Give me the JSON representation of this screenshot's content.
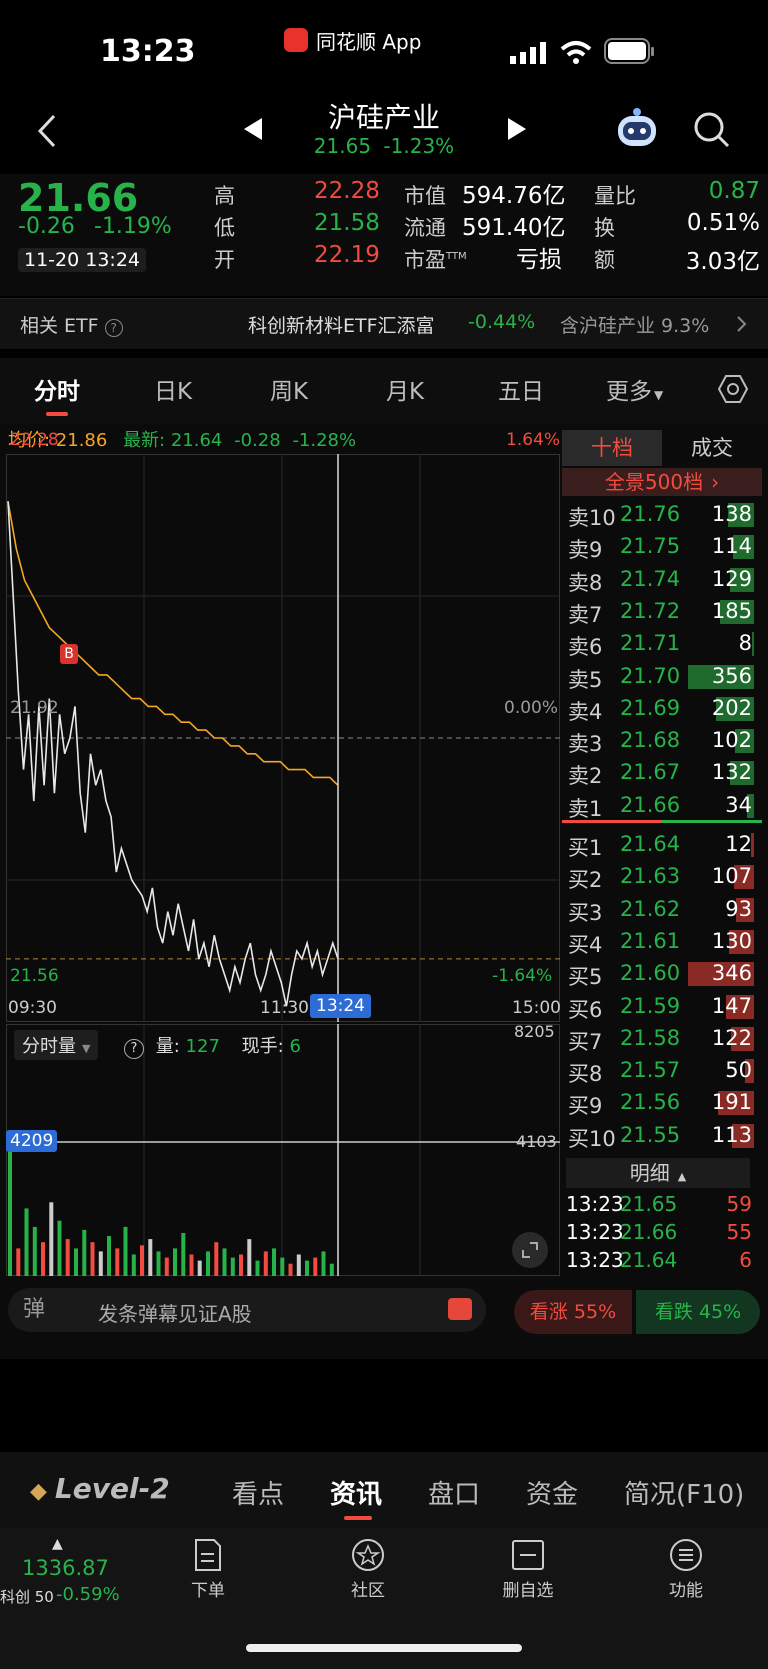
{
  "status_bar": {
    "time": "13:23",
    "app_name": "同花顺 App"
  },
  "header": {
    "title": "沪硅产业",
    "price": "21.65",
    "change_pct": "-1.23%"
  },
  "quote": {
    "price": "21.66",
    "change": "-0.26",
    "change_pct": "-1.19%",
    "datetime": "11-20 13:24",
    "high_label": "高",
    "high": "22.28",
    "low_label": "低",
    "low": "21.58",
    "open_label": "开",
    "open": "22.19",
    "mcap_label": "市值",
    "mcap": "594.76亿",
    "float_label": "流通",
    "float": "591.40亿",
    "pe_label": "市盈",
    "pe_sup": "TTM",
    "pe": "亏损",
    "vr_label": "量比",
    "vr": "0.87",
    "turnover_label": "换",
    "turnover": "0.51%",
    "amount_label": "额",
    "amount": "3.03亿"
  },
  "etf": {
    "label": "相关 ETF",
    "name": "科创新材料ETF汇添富",
    "change": "-0.44%",
    "holding": "含沪硅产业 9.3%"
  },
  "tabs": [
    "分时",
    "日K",
    "周K",
    "月K",
    "五日",
    "更多"
  ],
  "chart_info": {
    "avg_label": "均价: 21.86",
    "latest_label": "最新: 21.64",
    "latest_change": "-0.28",
    "latest_pct": "-1.28%"
  },
  "chart_data": {
    "type": "line",
    "x_ticks": [
      "09:30",
      "11:30",
      "15:00"
    ],
    "cursor_time": "13:24",
    "y_max": "22.28",
    "y_mid": "21.92",
    "y_min": "21.56",
    "pct_max": "1.64%",
    "pct_mid": "0.00%",
    "pct_min": "-1.64%",
    "ylim": [
      21.56,
      22.28
    ],
    "prev_close": 21.92,
    "price_series": [
      22.22,
      22.1,
      21.98,
      21.88,
      21.95,
      21.84,
      21.96,
      21.86,
      21.97,
      21.85,
      21.95,
      21.9,
      21.92,
      21.96,
      21.85,
      21.8,
      21.9,
      21.86,
      21.88,
      21.84,
      21.82,
      21.75,
      21.78,
      21.76,
      21.74,
      21.73,
      21.72,
      21.7,
      21.73,
      21.68,
      21.66,
      21.7,
      21.67,
      21.71,
      21.68,
      21.65,
      21.69,
      21.64,
      21.66,
      21.63,
      21.67,
      21.64,
      21.62,
      21.6,
      21.63,
      21.61,
      21.64,
      21.66,
      21.62,
      21.6,
      21.62,
      21.65,
      21.63,
      21.61,
      21.58,
      21.62,
      21.65,
      21.64,
      21.66,
      21.63,
      21.65,
      21.62,
      21.64,
      21.66,
      21.64
    ],
    "avg_series": [
      22.22,
      22.16,
      22.12,
      22.1,
      22.08,
      22.06,
      22.05,
      22.04,
      22.03,
      22.02,
      22.01,
      22.0,
      22.0,
      21.99,
      21.98,
      21.97,
      21.97,
      21.96,
      21.96,
      21.95,
      21.95,
      21.94,
      21.94,
      21.93,
      21.93,
      21.92,
      21.92,
      21.91,
      21.91,
      21.9,
      21.9,
      21.89,
      21.89,
      21.89,
      21.88,
      21.88,
      21.88,
      21.87,
      21.87,
      21.87,
      21.86
    ],
    "volume_series": [
      4209,
      900,
      2200,
      1600,
      1100,
      2400,
      1800,
      1200,
      900,
      1500,
      1100,
      800,
      1300,
      900,
      1600,
      700,
      1000,
      1200,
      800,
      600,
      900,
      1400,
      700,
      500,
      800,
      1100,
      900,
      600,
      700,
      1200,
      500,
      800,
      900,
      600,
      400,
      700,
      500,
      600,
      800,
      400
    ],
    "vol_max": "8205",
    "vol_mid": "4103",
    "vol_marker": "4209",
    "vol_selector": "分时量",
    "vol_label": "量:",
    "vol_value": "127",
    "hand_label": "现手:",
    "hand_value": "6"
  },
  "order_book": {
    "tab_active": "十档",
    "tab_other": "成交",
    "panorama": "全景500档",
    "asks": [
      {
        "label": "卖10",
        "price": "21.76",
        "vol": "138",
        "ratio": 0.39
      },
      {
        "label": "卖9",
        "price": "21.75",
        "vol": "114",
        "ratio": 0.32
      },
      {
        "label": "卖8",
        "price": "21.74",
        "vol": "129",
        "ratio": 0.36
      },
      {
        "label": "卖7",
        "price": "21.72",
        "vol": "185",
        "ratio": 0.52
      },
      {
        "label": "卖6",
        "price": "21.71",
        "vol": "8",
        "ratio": 0.02
      },
      {
        "label": "卖5",
        "price": "21.70",
        "vol": "356",
        "ratio": 1.0
      },
      {
        "label": "卖4",
        "price": "21.69",
        "vol": "202",
        "ratio": 0.57
      },
      {
        "label": "卖3",
        "price": "21.68",
        "vol": "102",
        "ratio": 0.29
      },
      {
        "label": "卖2",
        "price": "21.67",
        "vol": "132",
        "ratio": 0.37
      },
      {
        "label": "卖1",
        "price": "21.66",
        "vol": "34",
        "ratio": 0.1
      }
    ],
    "bids": [
      {
        "label": "买1",
        "price": "21.64",
        "vol": "12",
        "ratio": 0.04
      },
      {
        "label": "买2",
        "price": "21.63",
        "vol": "107",
        "ratio": 0.31
      },
      {
        "label": "买3",
        "price": "21.62",
        "vol": "93",
        "ratio": 0.27
      },
      {
        "label": "买4",
        "price": "21.61",
        "vol": "130",
        "ratio": 0.38
      },
      {
        "label": "买5",
        "price": "21.60",
        "vol": "346",
        "ratio": 1.0
      },
      {
        "label": "买6",
        "price": "21.59",
        "vol": "147",
        "ratio": 0.42
      },
      {
        "label": "买7",
        "price": "21.58",
        "vol": "122",
        "ratio": 0.35
      },
      {
        "label": "买8",
        "price": "21.57",
        "vol": "50",
        "ratio": 0.14
      },
      {
        "label": "买9",
        "price": "21.56",
        "vol": "191",
        "ratio": 0.55
      },
      {
        "label": "买10",
        "price": "21.55",
        "vol": "113",
        "ratio": 0.33
      }
    ],
    "detail_label": "明细",
    "details": [
      {
        "time": "13:23",
        "price": "21.65",
        "vol": "59"
      },
      {
        "time": "13:23",
        "price": "21.66",
        "vol": "55"
      },
      {
        "time": "13:23",
        "price": "21.64",
        "vol": "6"
      }
    ]
  },
  "danmu": {
    "icon": "弹",
    "placeholder": "发条弹幕见证A股",
    "up": "看涨 55%",
    "down": "看跌 45%"
  },
  "l2": {
    "logo": "Level-2",
    "tabs": [
      "看点",
      "资讯",
      "盘口",
      "资金",
      "简况(F10)"
    ],
    "active": "资讯"
  },
  "bottom": {
    "index_value": "1336.87",
    "index_name": "科创 50",
    "index_change": "-0.59%",
    "order": "下单",
    "community": "社区",
    "watchlist": "删自选",
    "function": "功能"
  },
  "colors": {
    "up": "#f24b3f",
    "down": "#27b34a",
    "avg_line": "#f5a623",
    "price_line": "#e8e8e8"
  }
}
